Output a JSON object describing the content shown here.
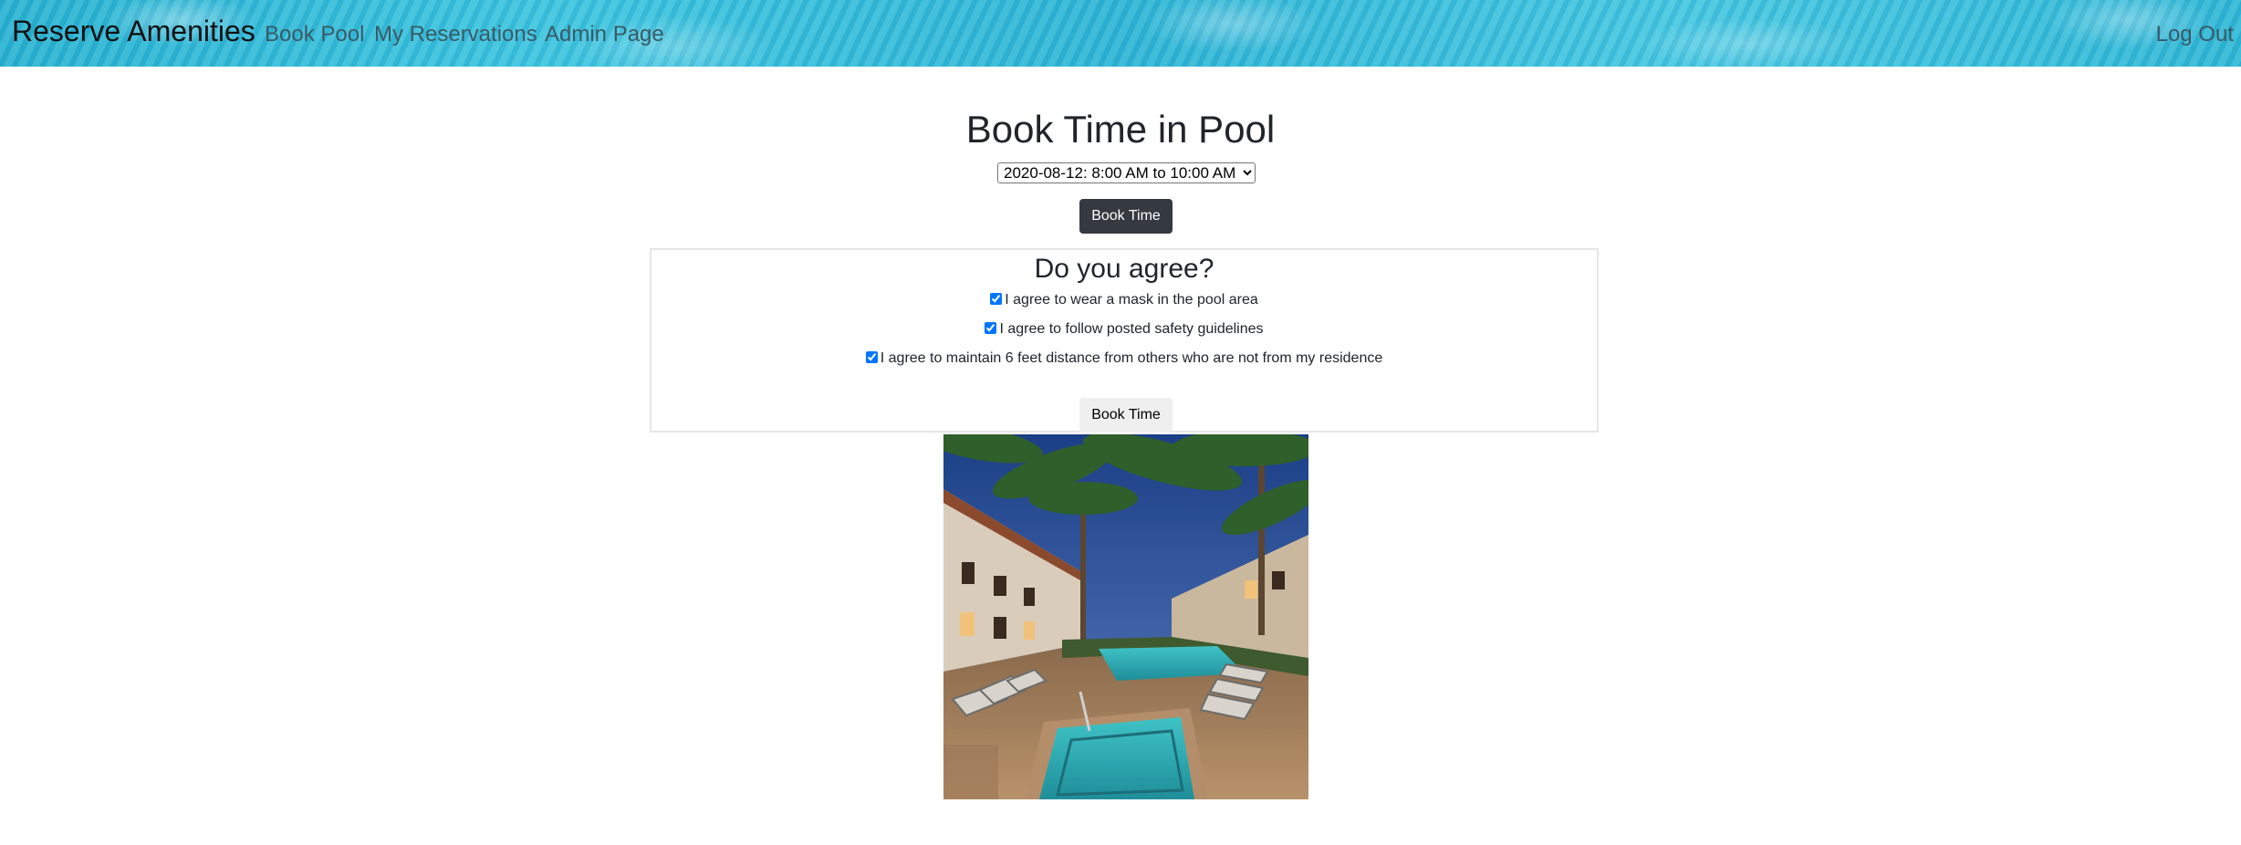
{
  "navbar": {
    "brand": "Reserve Amenities",
    "links": [
      {
        "label": "Book Pool"
      },
      {
        "label": "My Reservations"
      },
      {
        "label": "Admin Page"
      }
    ],
    "logout": "Log Out"
  },
  "booking": {
    "title": "Book Time in Pool",
    "selected_slot": "2020-08-12: 8:00 AM to 10:00 AM",
    "book_button": "Book Time"
  },
  "agreement": {
    "title": "Do you agree?",
    "items": [
      {
        "label": "I agree to wear a mask in the pool area",
        "checked": true
      },
      {
        "label": "I agree to follow posted safety guidelines",
        "checked": true
      },
      {
        "label": "I agree to maintain 6 feet distance from others who are not from my residence",
        "checked": true
      }
    ],
    "submit_button": "Book Time"
  },
  "colors": {
    "nav_water": "#3ec6e0",
    "dark_button": "#343a40",
    "light_button": "#efefef"
  }
}
